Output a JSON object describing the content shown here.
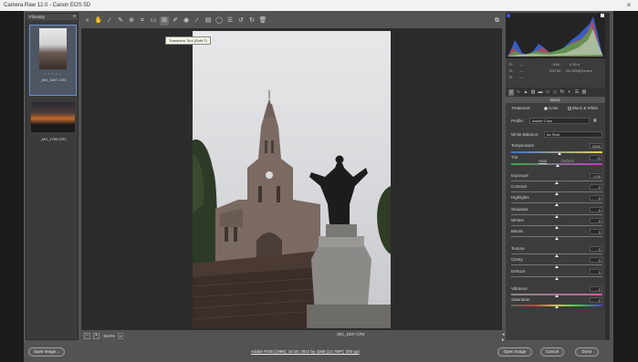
{
  "window": {
    "title": "Camera Raw 12.0  -  Canon EOS 5D",
    "close": "×"
  },
  "filmstrip": {
    "title": "Filmstrip",
    "thumbs": [
      {
        "name": "_MG_1837.CR2",
        "stars": "• • • • •"
      },
      {
        "name": "_MG_1785.CR2"
      }
    ]
  },
  "toolbar": {
    "tooltip": "Transform Tool (Shift-T)"
  },
  "canvas": {
    "zoom": "18.8%",
    "filename": "_MG_1837.CR2",
    "image_count": "Image 1/2",
    "nav_prev": "◂",
    "nav_next": "▸"
  },
  "histogram": {
    "r_label": "R:",
    "r_val": "---",
    "g_label": "G:",
    "g_val": "---",
    "b_label": "B:",
    "b_val": "---",
    "aperture": "f/16",
    "shutter": "0.30 s",
    "iso": "ISO 50",
    "lens": "24-105@24 mm"
  },
  "basic": {
    "section_title": "Basic",
    "treatment_label": "Treatment:",
    "treatment_color": "Color",
    "treatment_bw": "Black & White",
    "profile_label": "Profile:",
    "profile_value": "Adobe Color",
    "wb_label": "White Balance:",
    "wb_value": "As Shot",
    "temperature": {
      "label": "Temperature",
      "value": "5650",
      "position": 0.53
    },
    "tint": {
      "label": "Tint",
      "value": "+3",
      "position": 0.51
    },
    "auto": "Auto",
    "default": "Default",
    "sliders": [
      {
        "label": "Exposure",
        "value": "0.00"
      },
      {
        "label": "Contrast",
        "value": "0"
      },
      {
        "label": "Highlights",
        "value": "0"
      },
      {
        "label": "Shadows",
        "value": "0"
      },
      {
        "label": "Whites",
        "value": "0"
      },
      {
        "label": "Blacks",
        "value": "0"
      },
      {
        "label": "Texture",
        "value": "0"
      },
      {
        "label": "Clarity",
        "value": "0"
      },
      {
        "label": "Dehaze",
        "value": "0"
      },
      {
        "label": "Vibrance",
        "value": "0"
      },
      {
        "label": "Saturation",
        "value": "0"
      }
    ]
  },
  "bottom": {
    "save_label": "Save Image...",
    "workflow_link": "Adobe RGB (1998); 16 bit; 2912 by 4368 (12.7MP); 300 ppi",
    "open_label": "Open Image",
    "cancel_label": "Cancel",
    "done_label": "Done"
  }
}
